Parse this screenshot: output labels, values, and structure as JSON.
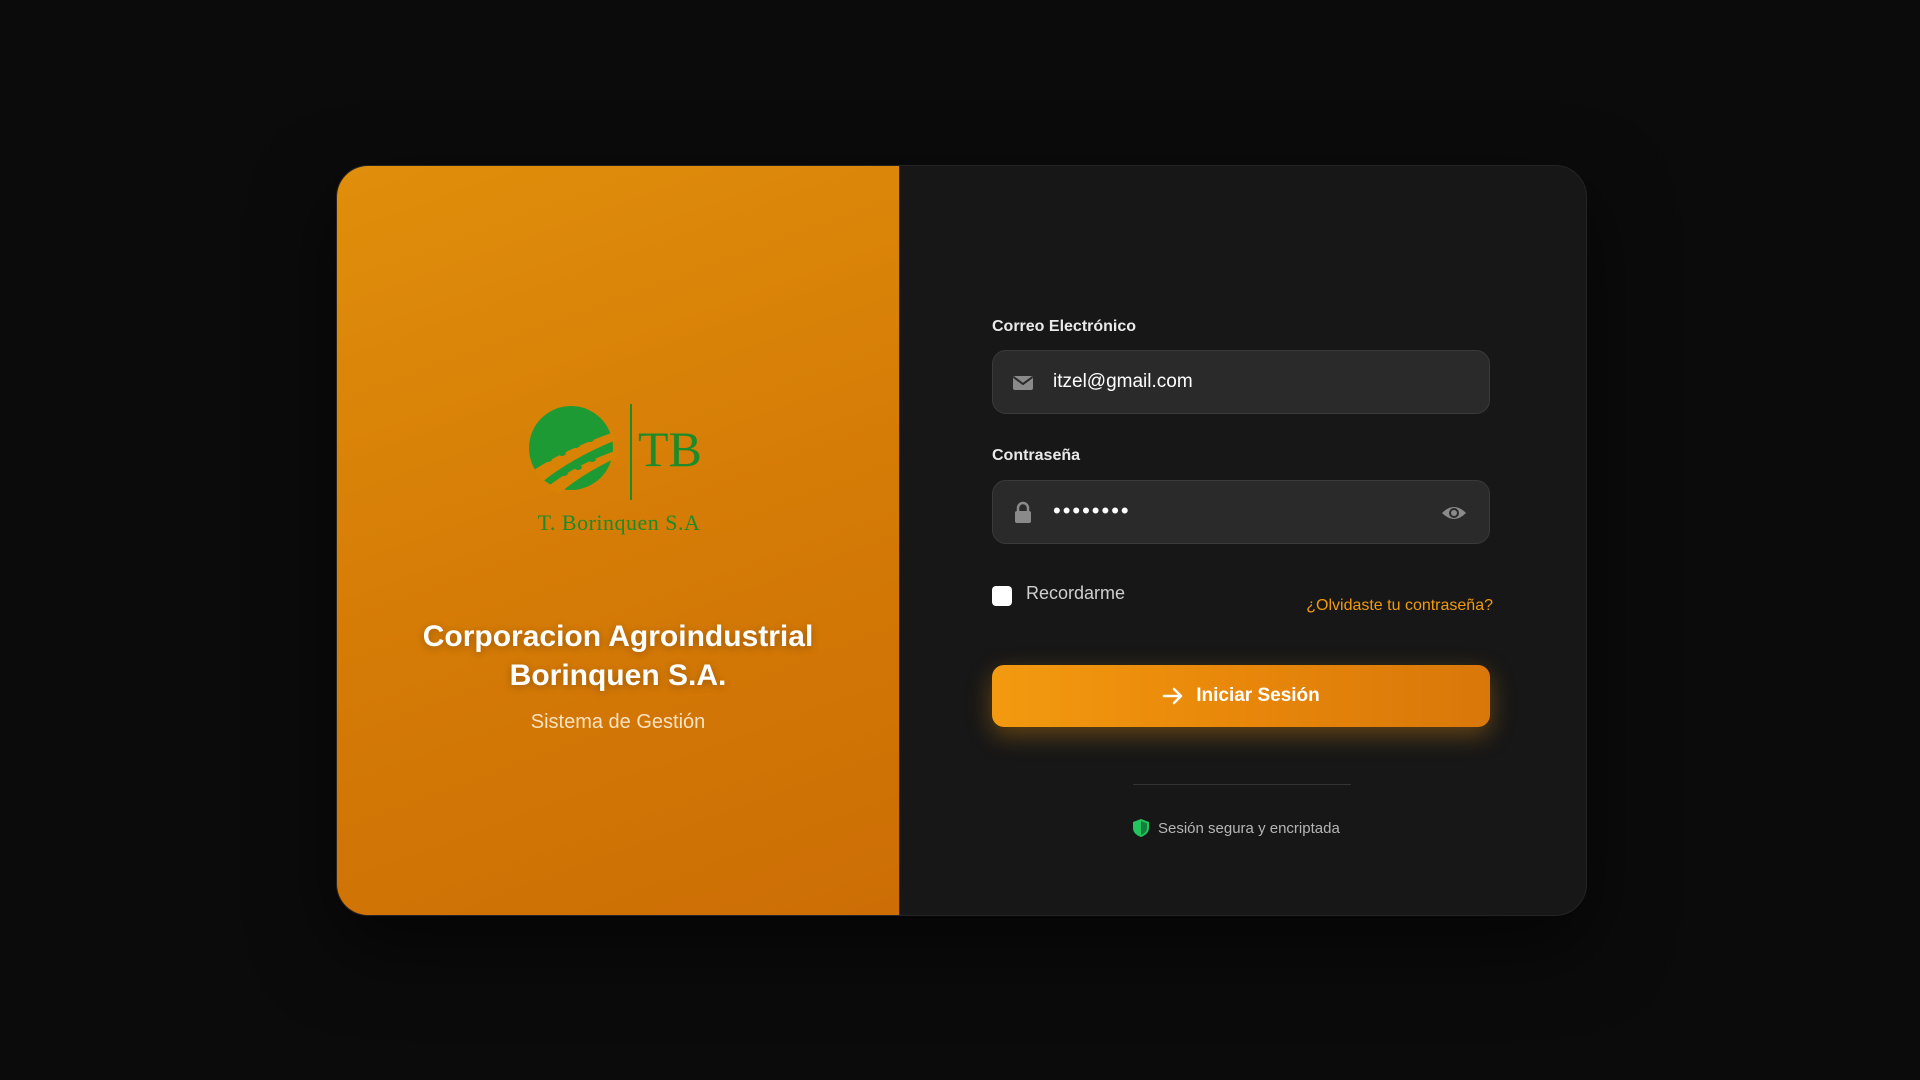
{
  "brand": {
    "logo_text": "T. Borinquen S.A",
    "logo_mark": "TB",
    "company_name_line1": "Corporacion Agroindustrial",
    "company_name_line2": "Borinquen S.A.",
    "subtitle": "Sistema de Gestión",
    "colors": {
      "panel_orange": "#d98306",
      "logo_green": "#1e8a2a",
      "accent": "#f29a0e"
    }
  },
  "form": {
    "email": {
      "label": "Correo Electrónico",
      "value": "itzel@gmail.com",
      "icon": "envelope-icon"
    },
    "password": {
      "label": "Contraseña",
      "value": "••••••••",
      "icon": "lock-icon",
      "toggle_icon": "eye-icon"
    },
    "remember": {
      "label": "Recordarme",
      "checked": false
    },
    "forgot_link": "¿Olvidaste tu contraseña?",
    "submit_label": "Iniciar Sesión",
    "submit_icon": "arrow-right-icon"
  },
  "footer": {
    "secure_text": "Sesión segura y encriptada",
    "secure_icon": "shield-icon",
    "secure_icon_color": "#22c55e"
  }
}
